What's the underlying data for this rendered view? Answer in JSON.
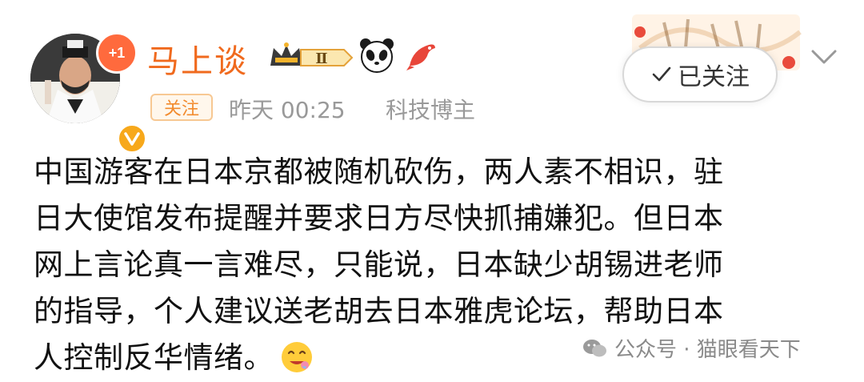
{
  "post": {
    "avatar_badge": "+1",
    "username": "马上谈",
    "level": "Ⅱ",
    "follow_tag": "关注",
    "time": "昨天 00:25",
    "category": "科技博主",
    "followed_label": "已关注",
    "text_lines": [
      "中国游客在日本京都被随机砍伤，两人素不相识，驻",
      "日大使馆发布提醒并要求日方尽快抓捕嫌犯。但日本",
      "网上言论真一言难尽，只能说，日本缺少胡锡进老师",
      "的指导，个人建议送老胡去日本雅虎论坛，帮助日本",
      "人控制反华情绪。"
    ]
  },
  "watermark": {
    "text": "公众号 · 猫眼看天下"
  },
  "colors": {
    "username": "#f06a1e",
    "follow_tag": "#f28b2e",
    "meta_gray": "#999999",
    "text": "#111111"
  },
  "icons": [
    "avatar",
    "verified-badge",
    "crown-level-icon",
    "panda-icon",
    "koi-fish-icon",
    "checkmark-icon",
    "chevron-down-icon",
    "wechat-icon",
    "drooling-emoji"
  ]
}
